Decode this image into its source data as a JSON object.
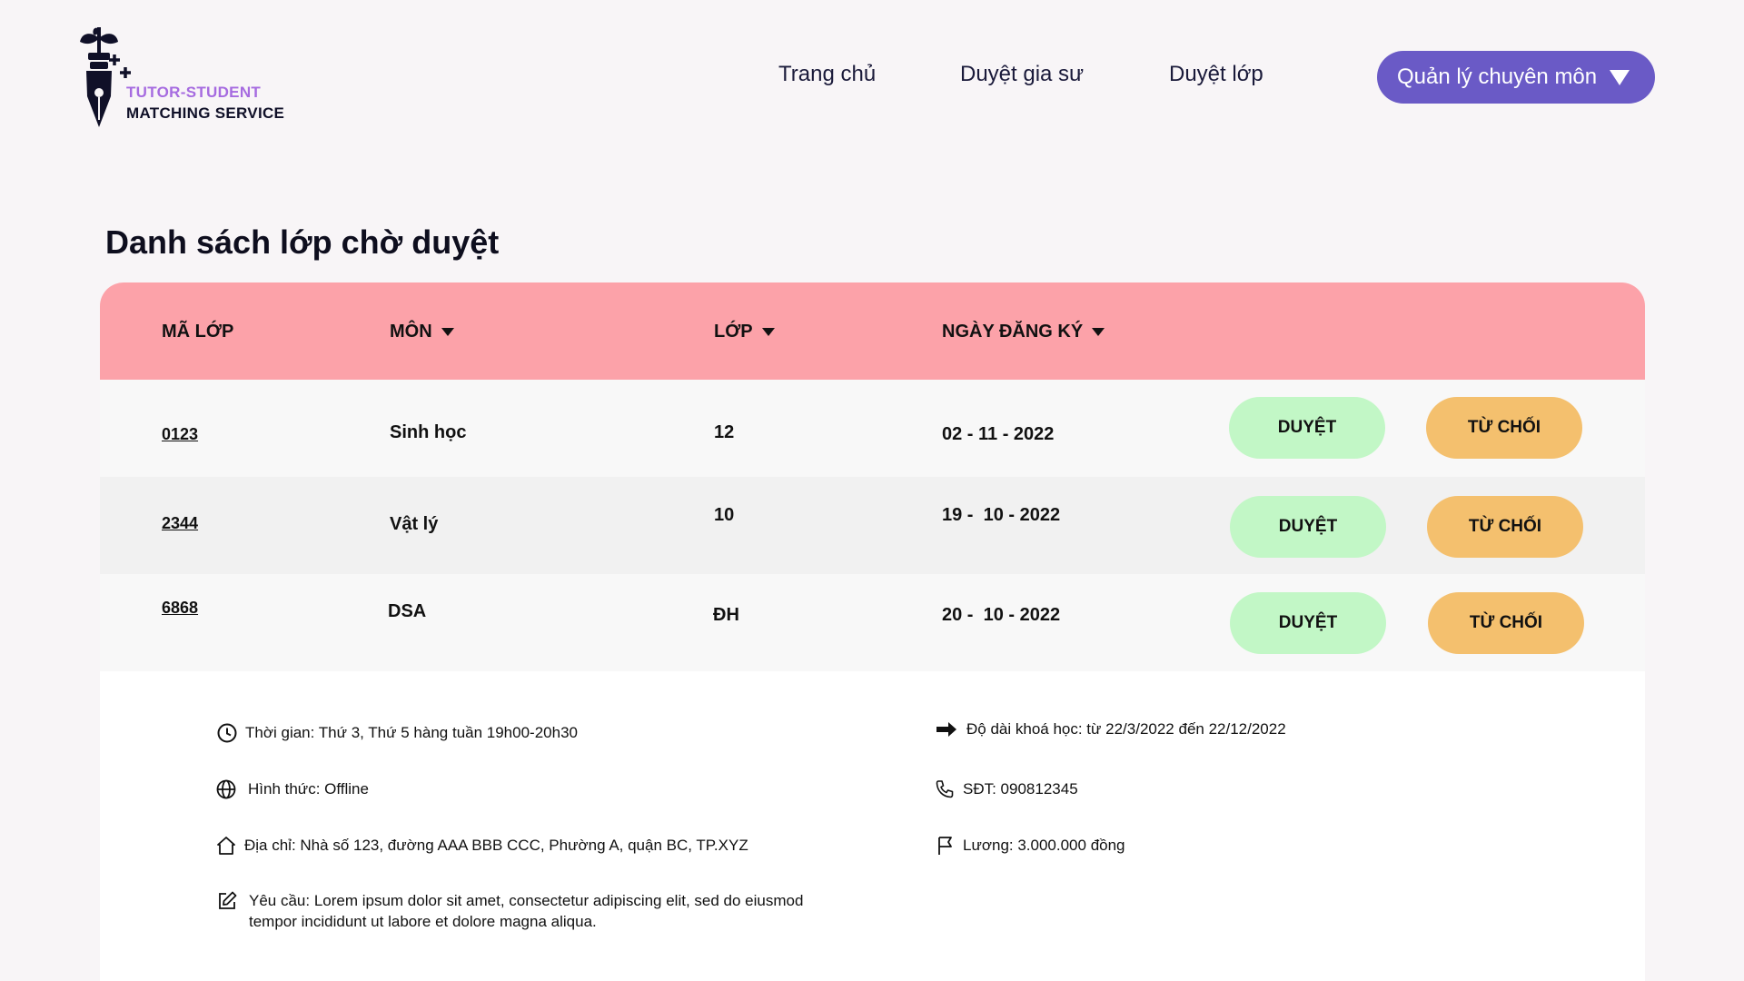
{
  "brand": {
    "line1": "TUTOR-STUDENT",
    "line2": "MATCHING SERVICE"
  },
  "nav": {
    "home": "Trang chủ",
    "tutors": "Duyệt gia sư",
    "classes": "Duyệt lớp",
    "manage": "Quản lý chuyên môn"
  },
  "page_title": "Danh sách lớp chờ duyệt",
  "table": {
    "headers": {
      "code": "MÃ LỚP",
      "subject": "MÔN",
      "grade": "LỚP",
      "date": "NGÀY ĐĂNG KÝ"
    },
    "rows": [
      {
        "code": "0123",
        "subject": "Sinh học",
        "grade": "12",
        "date": "02 - 11 - 2022",
        "approve": "DUYỆT",
        "reject": "TỪ CHỐI"
      },
      {
        "code": "2344",
        "subject": "Vật lý",
        "grade": "10",
        "date": "19 -  10 - 2022",
        "approve": "DUYỆT",
        "reject": "TỪ CHỐI"
      },
      {
        "code": "6868",
        "subject": "DSA",
        "grade": "ĐH",
        "date": "20 -  10 - 2022",
        "approve": "DUYỆT",
        "reject": "TỪ CHỐI"
      }
    ]
  },
  "details": {
    "time": "Thời gian: Thứ 3, Thứ 5 hàng tuần 19h00-20h30",
    "format": "Hình thức: Offline",
    "address": "Địa chỉ: Nhà số 123, đường AAA BBB CCC, Phường A, quận BC, TP.XYZ",
    "requirement": "Yêu cầu: Lorem ipsum dolor sit amet, consectetur adipiscing elit, sed do eiusmod tempor incididunt ut labore et dolore magna aliqua.",
    "duration": "Độ dài khoá học: từ 22/3/2022 đến 22/12/2022",
    "phone": "SĐT: 090812345",
    "salary": "Lương: 3.000.000 đồng"
  },
  "colors": {
    "header_bg": "#fca2a9",
    "manage_button": "#6a5ac6",
    "approve": "#c2f7c6",
    "reject": "#f4c06e",
    "brand_accent": "#a66be0"
  }
}
